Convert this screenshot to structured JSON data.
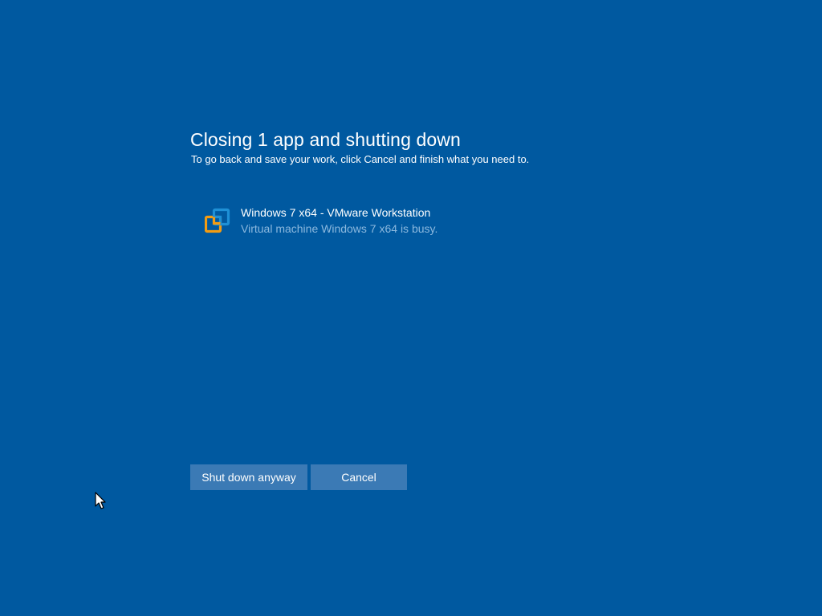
{
  "dialog": {
    "title": "Closing 1 app and shutting down",
    "subtitle": "To go back and save your work, click Cancel and finish what you need to."
  },
  "apps": [
    {
      "name": "Windows 7 x64 - VMware Workstation",
      "status": "Virtual machine Windows 7 x64 is busy.",
      "icon": "vmware-workstation-icon"
    }
  ],
  "buttons": {
    "shutdown_anyway": "Shut down anyway",
    "cancel": "Cancel"
  },
  "colors": {
    "background": "#0059a0",
    "button": "#3b7ab5",
    "status_text": "#8bb8de",
    "vmware_orange": "#f39c12",
    "vmware_blue": "#1e90d6"
  },
  "cursor": {
    "icon": "mouse-pointer-icon"
  }
}
